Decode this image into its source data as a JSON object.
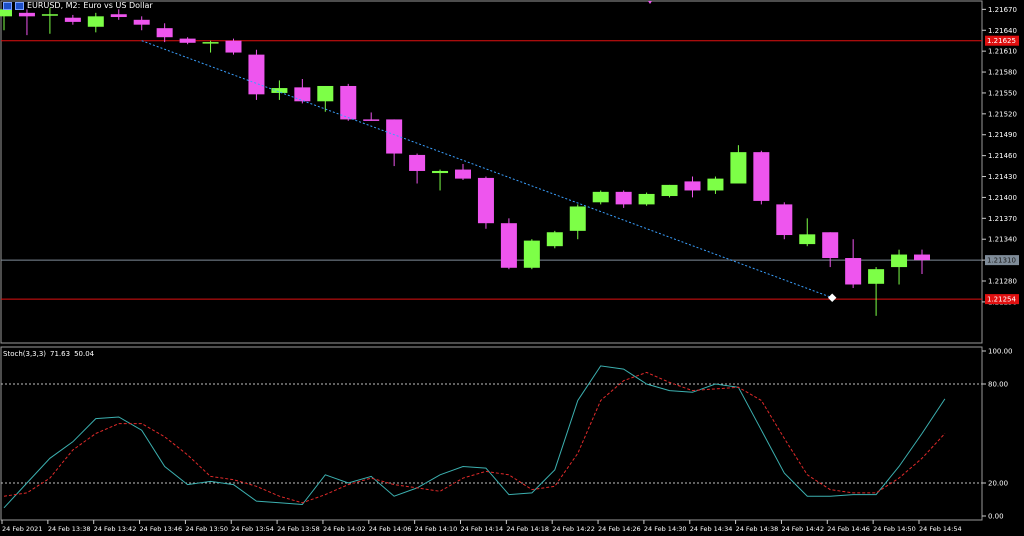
{
  "header": {
    "symbol": "EURUSD, M2:",
    "description": "Euro vs US Dollar"
  },
  "indicator": {
    "name": "Stoch(3,3,3)",
    "main_value": "71.63",
    "signal_value": "50.04"
  },
  "colors": {
    "bull": "#7dff47",
    "bear": "#ee55ee",
    "level_red": "#e01010",
    "bid_line": "#7f8c99",
    "trend_line": "#3aa0ff",
    "stoch_main": "#3cb0b0",
    "stoch_signal": "#e02a2a",
    "grid_dotted": "#c0c0c0"
  },
  "chart_data": [
    {
      "type": "candlestick",
      "ylim": [
        1.21191,
        1.21682
      ],
      "y_ticks": [
        "1.21670",
        "1.21640",
        "1.21610",
        "1.21580",
        "1.21550",
        "1.21520",
        "1.21490",
        "1.21460",
        "1.21430",
        "1.21400",
        "1.21370",
        "1.21340",
        "1.21310",
        "1.21280",
        "1.21250"
      ],
      "price_labels": [
        {
          "text": "1.21625",
          "price": 1.21625,
          "role": "level"
        },
        {
          "text": "1.21310",
          "price": 1.2131,
          "role": "bid"
        },
        {
          "text": "1.21254",
          "price": 1.21254,
          "role": "level"
        }
      ],
      "trend_line": {
        "from": {
          "index": 6,
          "price": 1.21625
        },
        "to": {
          "index": 36,
          "price": 1.21256
        }
      },
      "candles": [
        {
          "o": 1.2166,
          "h": 1.2168,
          "l": 1.2164,
          "c": 1.2167
        },
        {
          "o": 1.21665,
          "h": 1.2167,
          "l": 1.21633,
          "c": 1.2166
        },
        {
          "o": 1.21663,
          "h": 1.21672,
          "l": 1.21635,
          "c": 1.21663
        },
        {
          "o": 1.21658,
          "h": 1.21662,
          "l": 1.21648,
          "c": 1.21652
        },
        {
          "o": 1.21645,
          "h": 1.21665,
          "l": 1.21637,
          "c": 1.2166
        },
        {
          "o": 1.21663,
          "h": 1.2167,
          "l": 1.21655,
          "c": 1.21659
        },
        {
          "o": 1.21655,
          "h": 1.2166,
          "l": 1.2164,
          "c": 1.21648
        },
        {
          "o": 1.21643,
          "h": 1.2165,
          "l": 1.21623,
          "c": 1.2163
        },
        {
          "o": 1.21628,
          "h": 1.2163,
          "l": 1.2162,
          "c": 1.21622
        },
        {
          "o": 1.21621,
          "h": 1.21625,
          "l": 1.21608,
          "c": 1.21623
        },
        {
          "o": 1.21625,
          "h": 1.21628,
          "l": 1.21605,
          "c": 1.21608
        },
        {
          "o": 1.21605,
          "h": 1.21612,
          "l": 1.2154,
          "c": 1.21548
        },
        {
          "o": 1.2155,
          "h": 1.21568,
          "l": 1.2154,
          "c": 1.21557
        },
        {
          "o": 1.21558,
          "h": 1.2157,
          "l": 1.21535,
          "c": 1.21538
        },
        {
          "o": 1.21538,
          "h": 1.2156,
          "l": 1.21523,
          "c": 1.2156
        },
        {
          "o": 1.2156,
          "h": 1.21563,
          "l": 1.2151,
          "c": 1.21512
        },
        {
          "o": 1.21512,
          "h": 1.21522,
          "l": 1.2151,
          "c": 1.21511
        },
        {
          "o": 1.21512,
          "h": 1.21512,
          "l": 1.21445,
          "c": 1.21463
        },
        {
          "o": 1.21461,
          "h": 1.21463,
          "l": 1.2142,
          "c": 1.21438
        },
        {
          "o": 1.21435,
          "h": 1.2144,
          "l": 1.2141,
          "c": 1.21438
        },
        {
          "o": 1.2144,
          "h": 1.21448,
          "l": 1.21425,
          "c": 1.21427
        },
        {
          "o": 1.21428,
          "h": 1.2143,
          "l": 1.21355,
          "c": 1.21363
        },
        {
          "o": 1.21363,
          "h": 1.2137,
          "l": 1.21297,
          "c": 1.21299
        },
        {
          "o": 1.21299,
          "h": 1.2134,
          "l": 1.21297,
          "c": 1.21338
        },
        {
          "o": 1.2133,
          "h": 1.21352,
          "l": 1.21327,
          "c": 1.2135
        },
        {
          "o": 1.21352,
          "h": 1.2139,
          "l": 1.2134,
          "c": 1.21387
        },
        {
          "o": 1.21393,
          "h": 1.2141,
          "l": 1.2139,
          "c": 1.21408
        },
        {
          "o": 1.21408,
          "h": 1.2141,
          "l": 1.21385,
          "c": 1.2139
        },
        {
          "o": 1.2139,
          "h": 1.21407,
          "l": 1.21388,
          "c": 1.21405
        },
        {
          "o": 1.21402,
          "h": 1.21418,
          "l": 1.214,
          "c": 1.21418
        },
        {
          "o": 1.21423,
          "h": 1.2143,
          "l": 1.214,
          "c": 1.2141
        },
        {
          "o": 1.2141,
          "h": 1.2143,
          "l": 1.21405,
          "c": 1.21427
        },
        {
          "o": 1.2142,
          "h": 1.21475,
          "l": 1.2142,
          "c": 1.21465
        },
        {
          "o": 1.21465,
          "h": 1.21467,
          "l": 1.2139,
          "c": 1.21395
        },
        {
          "o": 1.2139,
          "h": 1.21393,
          "l": 1.2134,
          "c": 1.21346
        },
        {
          "o": 1.21333,
          "h": 1.2137,
          "l": 1.2133,
          "c": 1.21347
        },
        {
          "o": 1.2135,
          "h": 1.2135,
          "l": 1.213,
          "c": 1.21313
        },
        {
          "o": 1.21313,
          "h": 1.2134,
          "l": 1.2127,
          "c": 1.21275
        },
        {
          "o": 1.21276,
          "h": 1.213,
          "l": 1.2123,
          "c": 1.21297
        },
        {
          "o": 1.213,
          "h": 1.21325,
          "l": 1.21275,
          "c": 1.21318
        },
        {
          "o": 1.21318,
          "h": 1.21325,
          "l": 1.2129,
          "c": 1.2131
        }
      ]
    },
    {
      "type": "line",
      "title": "Stoch(3,3,3)",
      "ylim": [
        0,
        100
      ],
      "y_ticks": [
        "100.00",
        "80.00",
        "20.00",
        "0.00"
      ],
      "levels": [
        80,
        20
      ],
      "x_labels": [
        "24 Feb 2021",
        "24 Feb 13:38",
        "24 Feb 13:42",
        "24 Feb 13:46",
        "24 Feb 13:50",
        "24 Feb 13:54",
        "24 Feb 13:58",
        "24 Feb 14:02",
        "24 Feb 14:06",
        "24 Feb 14:10",
        "24 Feb 14:14",
        "24 Feb 14:18",
        "24 Feb 14:22",
        "24 Feb 14:26",
        "24 Feb 14:30",
        "24 Feb 14:34",
        "24 Feb 14:38",
        "24 Feb 14:42",
        "24 Feb 14:46",
        "24 Feb 14:50",
        "24 Feb 14:54"
      ],
      "series": [
        {
          "values": [
            5,
            20,
            35,
            45,
            59,
            60,
            52,
            30,
            19,
            21,
            19,
            9,
            8,
            7,
            25,
            20,
            24,
            12,
            17,
            25,
            30,
            29,
            13,
            14,
            28,
            70,
            91,
            89,
            80,
            76,
            75,
            80,
            78,
            52,
            26,
            12,
            12,
            13,
            13,
            30,
            50,
            71
          ]
        },
        {
          "values": [
            12,
            14,
            23,
            40,
            50,
            56,
            56,
            48,
            37,
            24,
            22,
            18,
            12,
            8,
            13,
            19,
            23,
            19,
            17,
            15,
            23,
            27,
            25,
            16,
            18,
            38,
            70,
            82,
            87,
            81,
            76,
            77,
            78,
            70,
            47,
            25,
            16,
            14,
            14,
            23,
            35,
            50
          ]
        }
      ]
    }
  ]
}
